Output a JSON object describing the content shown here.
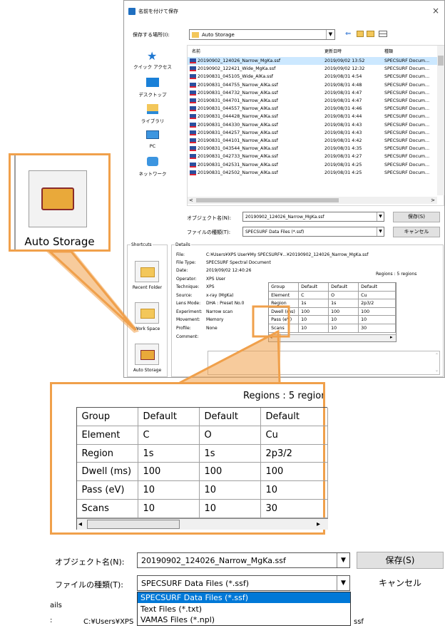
{
  "dialog": {
    "title": "名前を付けて保存",
    "close_glyph": "×",
    "save_in_label": "保存する場所(I):",
    "save_in_value": "Auto Storage",
    "columns": [
      "名前",
      "更新日時",
      "種類"
    ],
    "nav": [
      "クイック アクセス",
      "デスクトップ",
      "ライブラリ",
      "PC",
      "ネットワーク"
    ],
    "files": [
      [
        "20190902_124026_Narrow_MgKa.ssf",
        "2019/09/02 13:52",
        "SPECSURF Docum..."
      ],
      [
        "20190902_122421_Wide_MgKa.ssf",
        "2019/09/02 12:32",
        "SPECSURF Docum..."
      ],
      [
        "20190831_045105_Wide_AlKa.ssf",
        "2019/08/31 4:54",
        "SPECSURF Docum..."
      ],
      [
        "20190831_044755_Narrow_AlKa.ssf",
        "2019/08/31 4:48",
        "SPECSURF Docum..."
      ],
      [
        "20190831_044732_Narrow_AlKa.ssf",
        "2019/08/31 4:47",
        "SPECSURF Docum..."
      ],
      [
        "20190831_044701_Narrow_AlKa.ssf",
        "2019/08/31 4:47",
        "SPECSURF Docum..."
      ],
      [
        "20190831_044557_Narrow_AlKa.ssf",
        "2019/08/31 4:46",
        "SPECSURF Docum..."
      ],
      [
        "20190831_044428_Narrow_AlKa.ssf",
        "2019/08/31 4:44",
        "SPECSURF Docum..."
      ],
      [
        "20190831_044330_Narrow_AlKa.ssf",
        "2019/08/31 4:43",
        "SPECSURF Docum..."
      ],
      [
        "20190831_044257_Narrow_AlKa.ssf",
        "2019/08/31 4:43",
        "SPECSURF Docum..."
      ],
      [
        "20190831_044101_Narrow_AlKa.ssf",
        "2019/08/31 4:42",
        "SPECSURF Docum..."
      ],
      [
        "20190831_043544_Narrow_AlKa.ssf",
        "2019/08/31 4:35",
        "SPECSURF Docum..."
      ],
      [
        "20190831_042733_Narrow_AlKa.ssf",
        "2019/08/31 4:27",
        "SPECSURF Docum..."
      ],
      [
        "20190831_042531_Narrow_AlKa.ssf",
        "2019/08/31 4:25",
        "SPECSURF Docum..."
      ],
      [
        "20190831_042502_Narrow_AlKa.ssf",
        "2019/08/31 4:25",
        "SPECSURF Docum..."
      ]
    ],
    "object_name_label": "オブジェクト名(N):",
    "object_name_value": "20190902_124026_Narrow_MgKa.ssf",
    "file_type_label": "ファイルの種類(T):",
    "file_type_value": "SPECSURF Data Files (*.ssf)",
    "save_button": "保存(S)",
    "cancel_button": "キャンセル"
  },
  "shortcuts": {
    "title": "Shortcuts",
    "items": [
      "Recent Folder",
      "Work Space",
      "Auto Storage"
    ]
  },
  "details": {
    "title": "Details",
    "fields": [
      [
        "File:",
        "C:¥Users¥XPS User¥My SPECSURF¥...¥20190902_124026_Narrow_MgKa.ssf"
      ],
      [
        "File Type:",
        "SPECSURF Spectral Document"
      ],
      [
        "Date:",
        "2019/09/02 12:40:26"
      ],
      [
        "Operator:",
        "XPS User"
      ],
      [
        "Technique:",
        "XPS"
      ],
      [
        "Source:",
        "x-ray (MgKa)"
      ],
      [
        "Lens Mode:",
        "DHA : Preset No.0"
      ],
      [
        "Experiment:",
        "Narrow scan"
      ],
      [
        "Movement:",
        "Memory"
      ],
      [
        "Profile:",
        "None"
      ],
      [
        "Comment:",
        ""
      ]
    ],
    "regions_label": "Regions : 5 regions",
    "table": [
      [
        "Group",
        "Default",
        "Default",
        "Default"
      ],
      [
        "Element",
        "C",
        "O",
        "Cu"
      ],
      [
        "Region",
        "1s",
        "1s",
        "2p3/2"
      ],
      [
        "Dwell (ms)",
        "100",
        "100",
        "100"
      ],
      [
        "Pass (eV)",
        "10",
        "10",
        "10"
      ],
      [
        "Scans",
        "10",
        "10",
        "30"
      ]
    ]
  },
  "zoom_left": {
    "label": "Auto Storage"
  },
  "zoom_table": {
    "regions_label": "Regions : 5 regions"
  },
  "zoom_bottom": {
    "object_name_label": "オブジェクト名(N):",
    "object_name_value": "20190902_124026_Narrow_MgKa.ssf",
    "save_button": "保存(S)",
    "file_type_label": "ファイルの種類(T):",
    "file_type_value": "SPECSURF Data Files (*.ssf)",
    "cancel_button": "キャンセル",
    "options": [
      "SPECSURF Data Files (*.ssf)",
      "Text Files (*.txt)",
      "VAMAS Files (*.npl)"
    ],
    "behind_details": "ails",
    "behind_colon": ":",
    "behind_path": "C:¥Users¥XPS",
    "behind_ssf": "ssf"
  },
  "colors": {
    "accent": "#f0a04b",
    "selection": "#cce8ff",
    "dropdown_selected": "#0078d7",
    "folder": "#f3c75a"
  }
}
